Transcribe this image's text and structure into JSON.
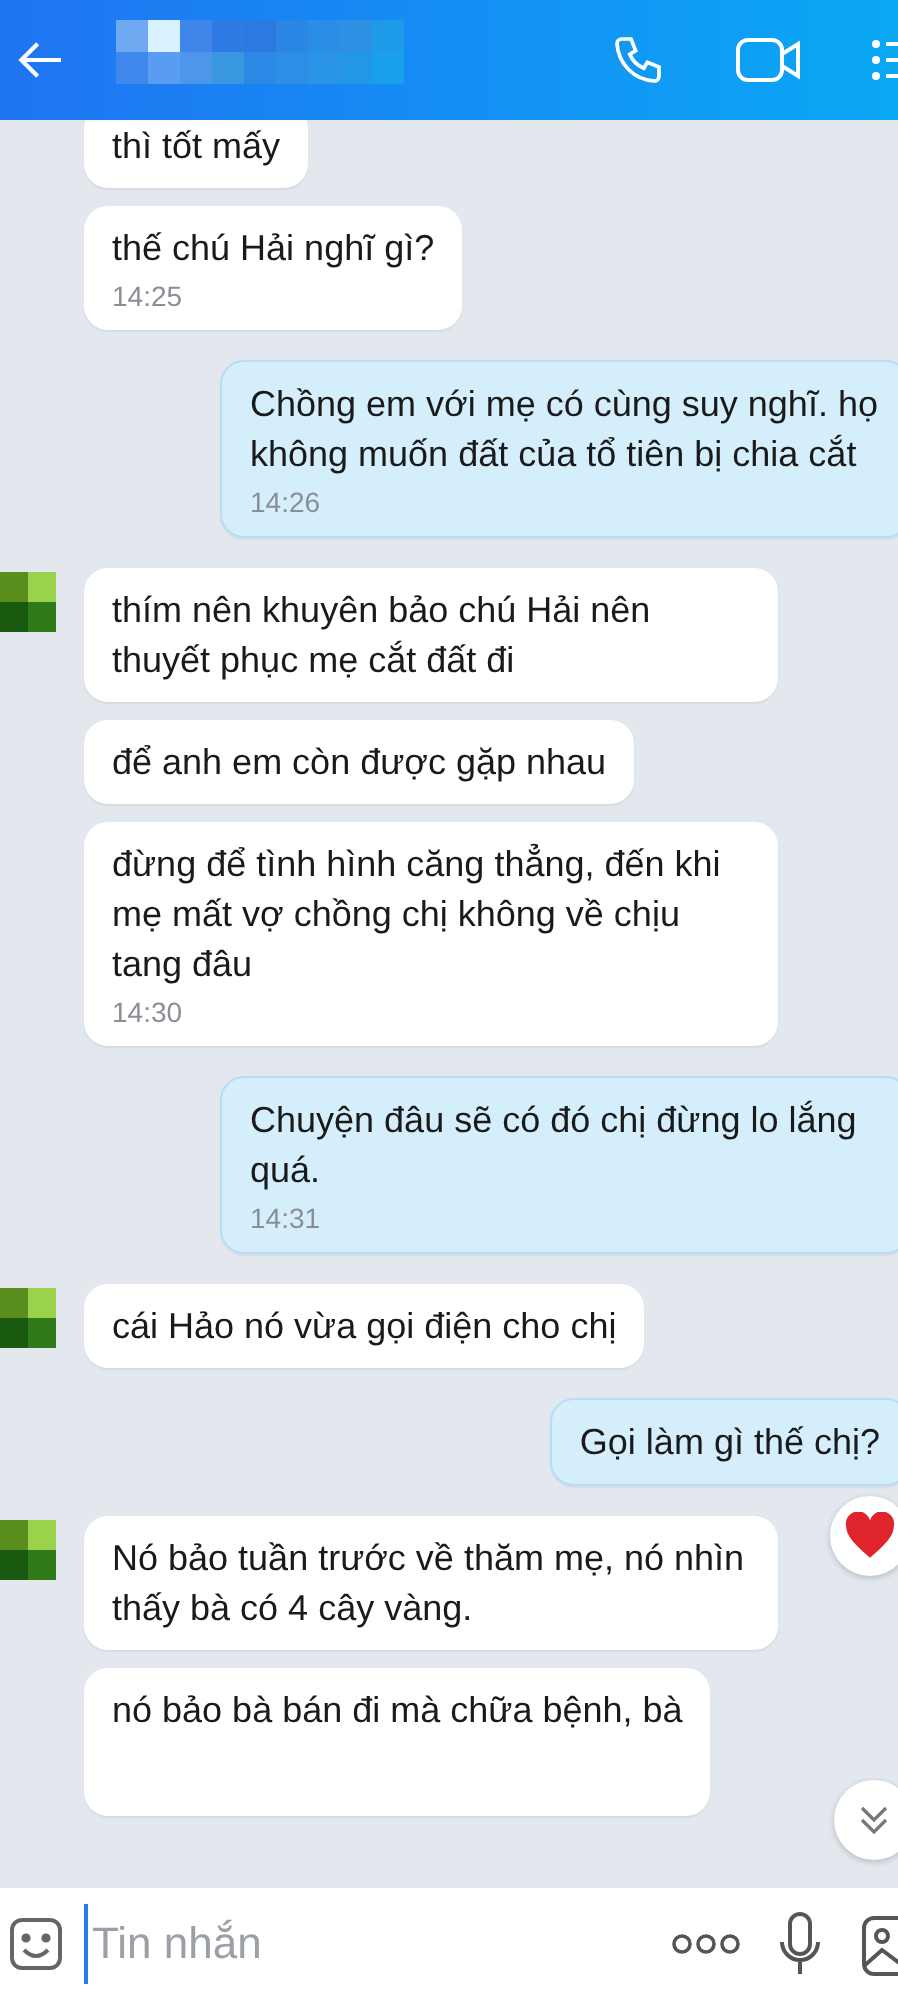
{
  "messages": [
    {
      "outgoing": false,
      "text": "thì tốt mấy",
      "avatar": false
    },
    {
      "outgoing": false,
      "text": "thế chú Hải nghĩ gì?",
      "time": "14:25",
      "avatar": false
    },
    {
      "outgoing": true,
      "text": "Chồng em với mẹ có cùng suy nghĩ. họ không muốn đất của tổ tiên bị chia cắt",
      "time": "14:26"
    },
    {
      "outgoing": false,
      "text": "thím nên khuyên bảo chú Hải nên thuyết phục mẹ cắt đất đi",
      "avatar": true
    },
    {
      "outgoing": false,
      "text": "để anh em còn được gặp nhau",
      "avatar": false
    },
    {
      "outgoing": false,
      "text": "đừng để tình hình căng thẳng, đến khi mẹ mất vợ chồng chị không về chịu tang đâu",
      "time": "14:30",
      "avatar": false
    },
    {
      "outgoing": true,
      "text": "Chuyện đâu sẽ có đó chị đừng lo lắng quá.",
      "time": "14:31"
    },
    {
      "outgoing": false,
      "text": "cái Hảo nó vừa gọi điện cho chị",
      "avatar": true
    },
    {
      "outgoing": true,
      "text": "Gọi làm gì thế chị?"
    },
    {
      "outgoing": false,
      "text": "Nó bảo tuần trước về thăm mẹ, nó nhìn thấy bà có 4 cây vàng.",
      "avatar": true,
      "hearted": true
    },
    {
      "outgoing": false,
      "text": "nó bảo bà bán đi mà chữa bệnh, bà",
      "avatar": false
    }
  ],
  "composer": {
    "placeholder": "Tin nhắn"
  }
}
